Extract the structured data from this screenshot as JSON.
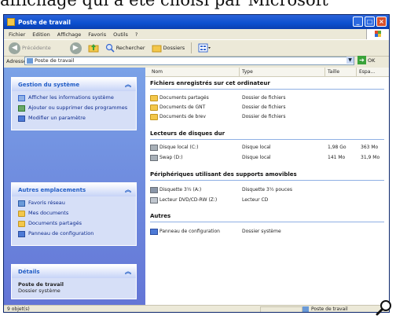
{
  "caption_fragment": "affichage qui a été choisi par Microsoft",
  "window": {
    "title": "Poste de travail",
    "controls": {
      "minimize": "_",
      "maximize": "□",
      "close": "×"
    }
  },
  "menu": [
    "Fichier",
    "Edition",
    "Affichage",
    "Favoris",
    "Outils",
    "?"
  ],
  "toolbar": {
    "back_label": "Précédente",
    "search_label": "Rechercher",
    "folders_label": "Dossiers"
  },
  "address": {
    "label": "Adresse",
    "value": "Poste de travail",
    "go_label": "OK"
  },
  "tasks": {
    "system": {
      "title": "Gestion du système",
      "items": [
        "Afficher les informations système",
        "Ajouter ou supprimer des programmes",
        "Modifier un paramètre"
      ]
    },
    "places": {
      "title": "Autres emplacements",
      "items": [
        "Favoris réseau",
        "Mes documents",
        "Documents partagés",
        "Panneau de configuration"
      ]
    },
    "details": {
      "title": "Détails",
      "name": "Poste de travail",
      "desc": "Dossier système"
    }
  },
  "columns": {
    "name": "Nom",
    "type": "Type",
    "size": "Taille",
    "free": "Espa..."
  },
  "groups": [
    {
      "title": "Fichiers enregistrés sur cet ordinateur",
      "items": [
        {
          "name": "Documents partagés",
          "type": "Dossier de fichiers",
          "size": "",
          "free": ""
        },
        {
          "name": "Documents de GNT",
          "type": "Dossier de fichiers",
          "size": "",
          "free": ""
        },
        {
          "name": "Documents de brev",
          "type": "Dossier de fichiers",
          "size": "",
          "free": ""
        }
      ]
    },
    {
      "title": "Lecteurs de disques dur",
      "items": [
        {
          "name": "Disque local (C:)",
          "type": "Disque local",
          "size": "1,98 Go",
          "free": "363 Mo"
        },
        {
          "name": "Swap (D:)",
          "type": "Disque local",
          "size": "141 Mo",
          "free": "31,9 Mo"
        }
      ]
    },
    {
      "title": "Périphériques utilisant des supports amovibles",
      "items": [
        {
          "name": "Disquette 3½ (A:)",
          "type": "Disquette 3½ pouces",
          "size": "",
          "free": ""
        },
        {
          "name": "Lecteur DVD/CD-RW (Z:)",
          "type": "Lecteur CD",
          "size": "",
          "free": ""
        }
      ]
    },
    {
      "title": "Autres",
      "items": [
        {
          "name": "Panneau de configuration",
          "type": "Dossier système",
          "size": "",
          "free": ""
        }
      ]
    }
  ],
  "status": {
    "objects": "9 objet(s)",
    "location": "Poste de travail"
  }
}
